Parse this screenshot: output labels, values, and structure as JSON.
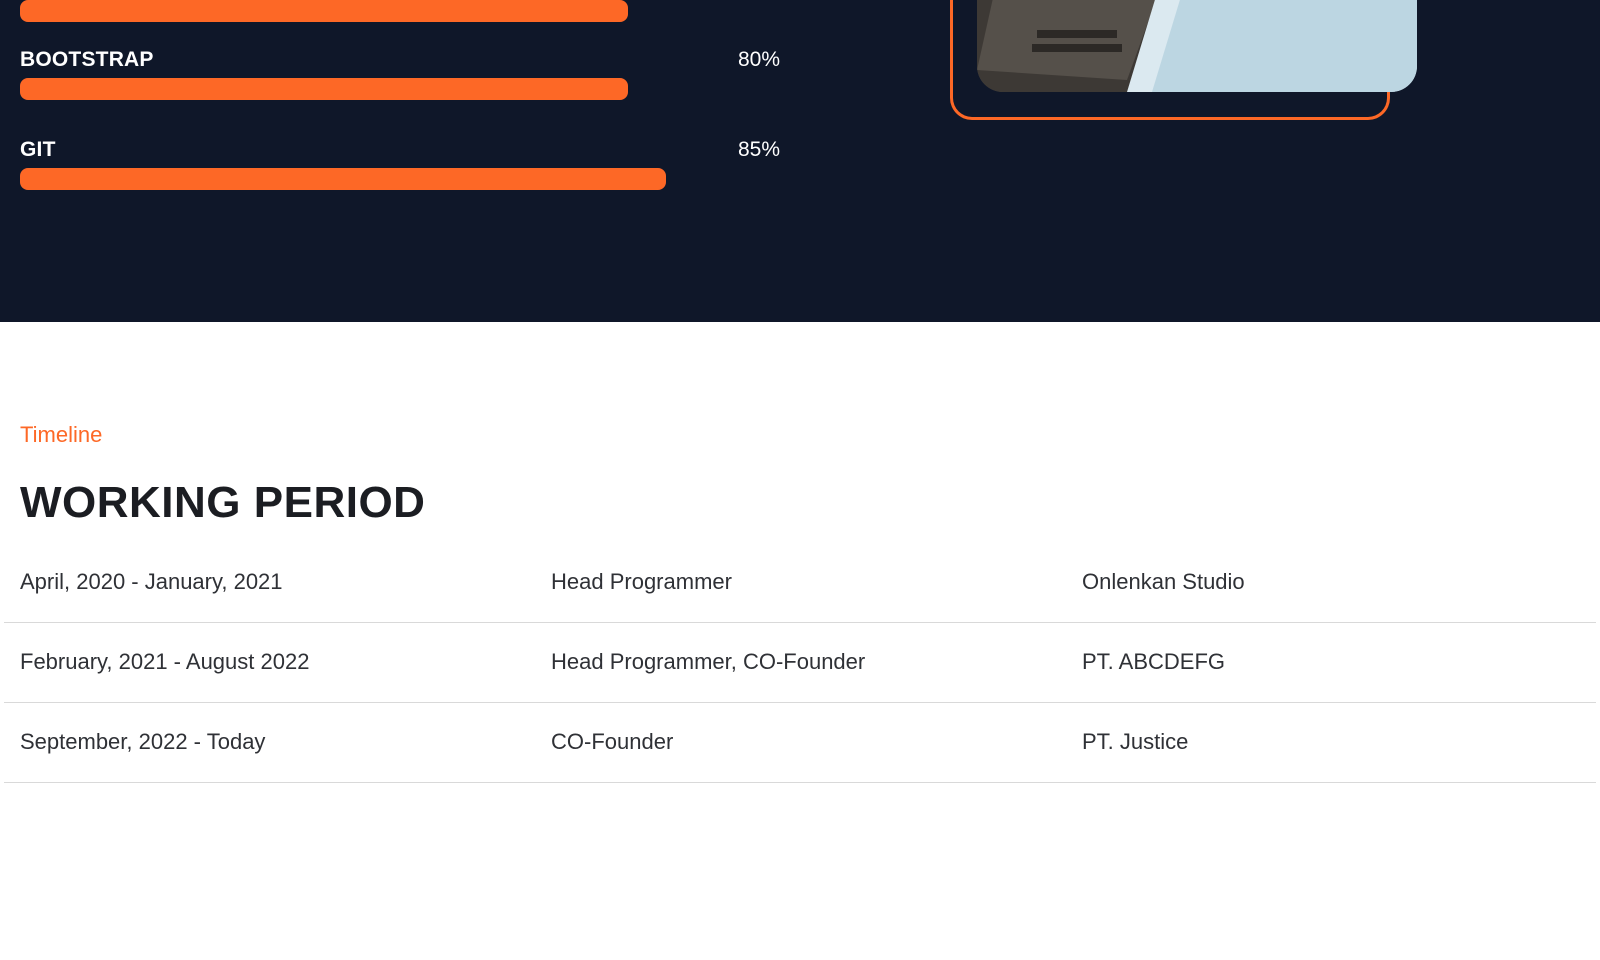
{
  "colors": {
    "dark_background": "#0f1729",
    "accent": "#fd6826",
    "heading_text": "#1b1d22",
    "body_text": "#2f3136",
    "divider": "#d9d9d9"
  },
  "skills": [
    {
      "name": "",
      "percent_label": "",
      "level": 0.8
    },
    {
      "name": "BOOTSTRAP",
      "percent_label": "80%",
      "level": 0.8
    },
    {
      "name": "GIT",
      "percent_label": "85%",
      "level": 0.85
    }
  ],
  "photo": {
    "icon": "laptop-photo"
  },
  "timeline": {
    "eyebrow": "Timeline",
    "title": "WORKING PERIOD",
    "rows": [
      {
        "period": "April, 2020 - January, 2021",
        "role": "Head Programmer",
        "company": "Onlenkan Studio"
      },
      {
        "period": "February, 2021 - August 2022",
        "role": "Head Programmer, CO-Founder",
        "company": "PT. ABCDEFG"
      },
      {
        "period": "September, 2022 - Today",
        "role": "CO-Founder",
        "company": "PT. Justice"
      }
    ]
  }
}
